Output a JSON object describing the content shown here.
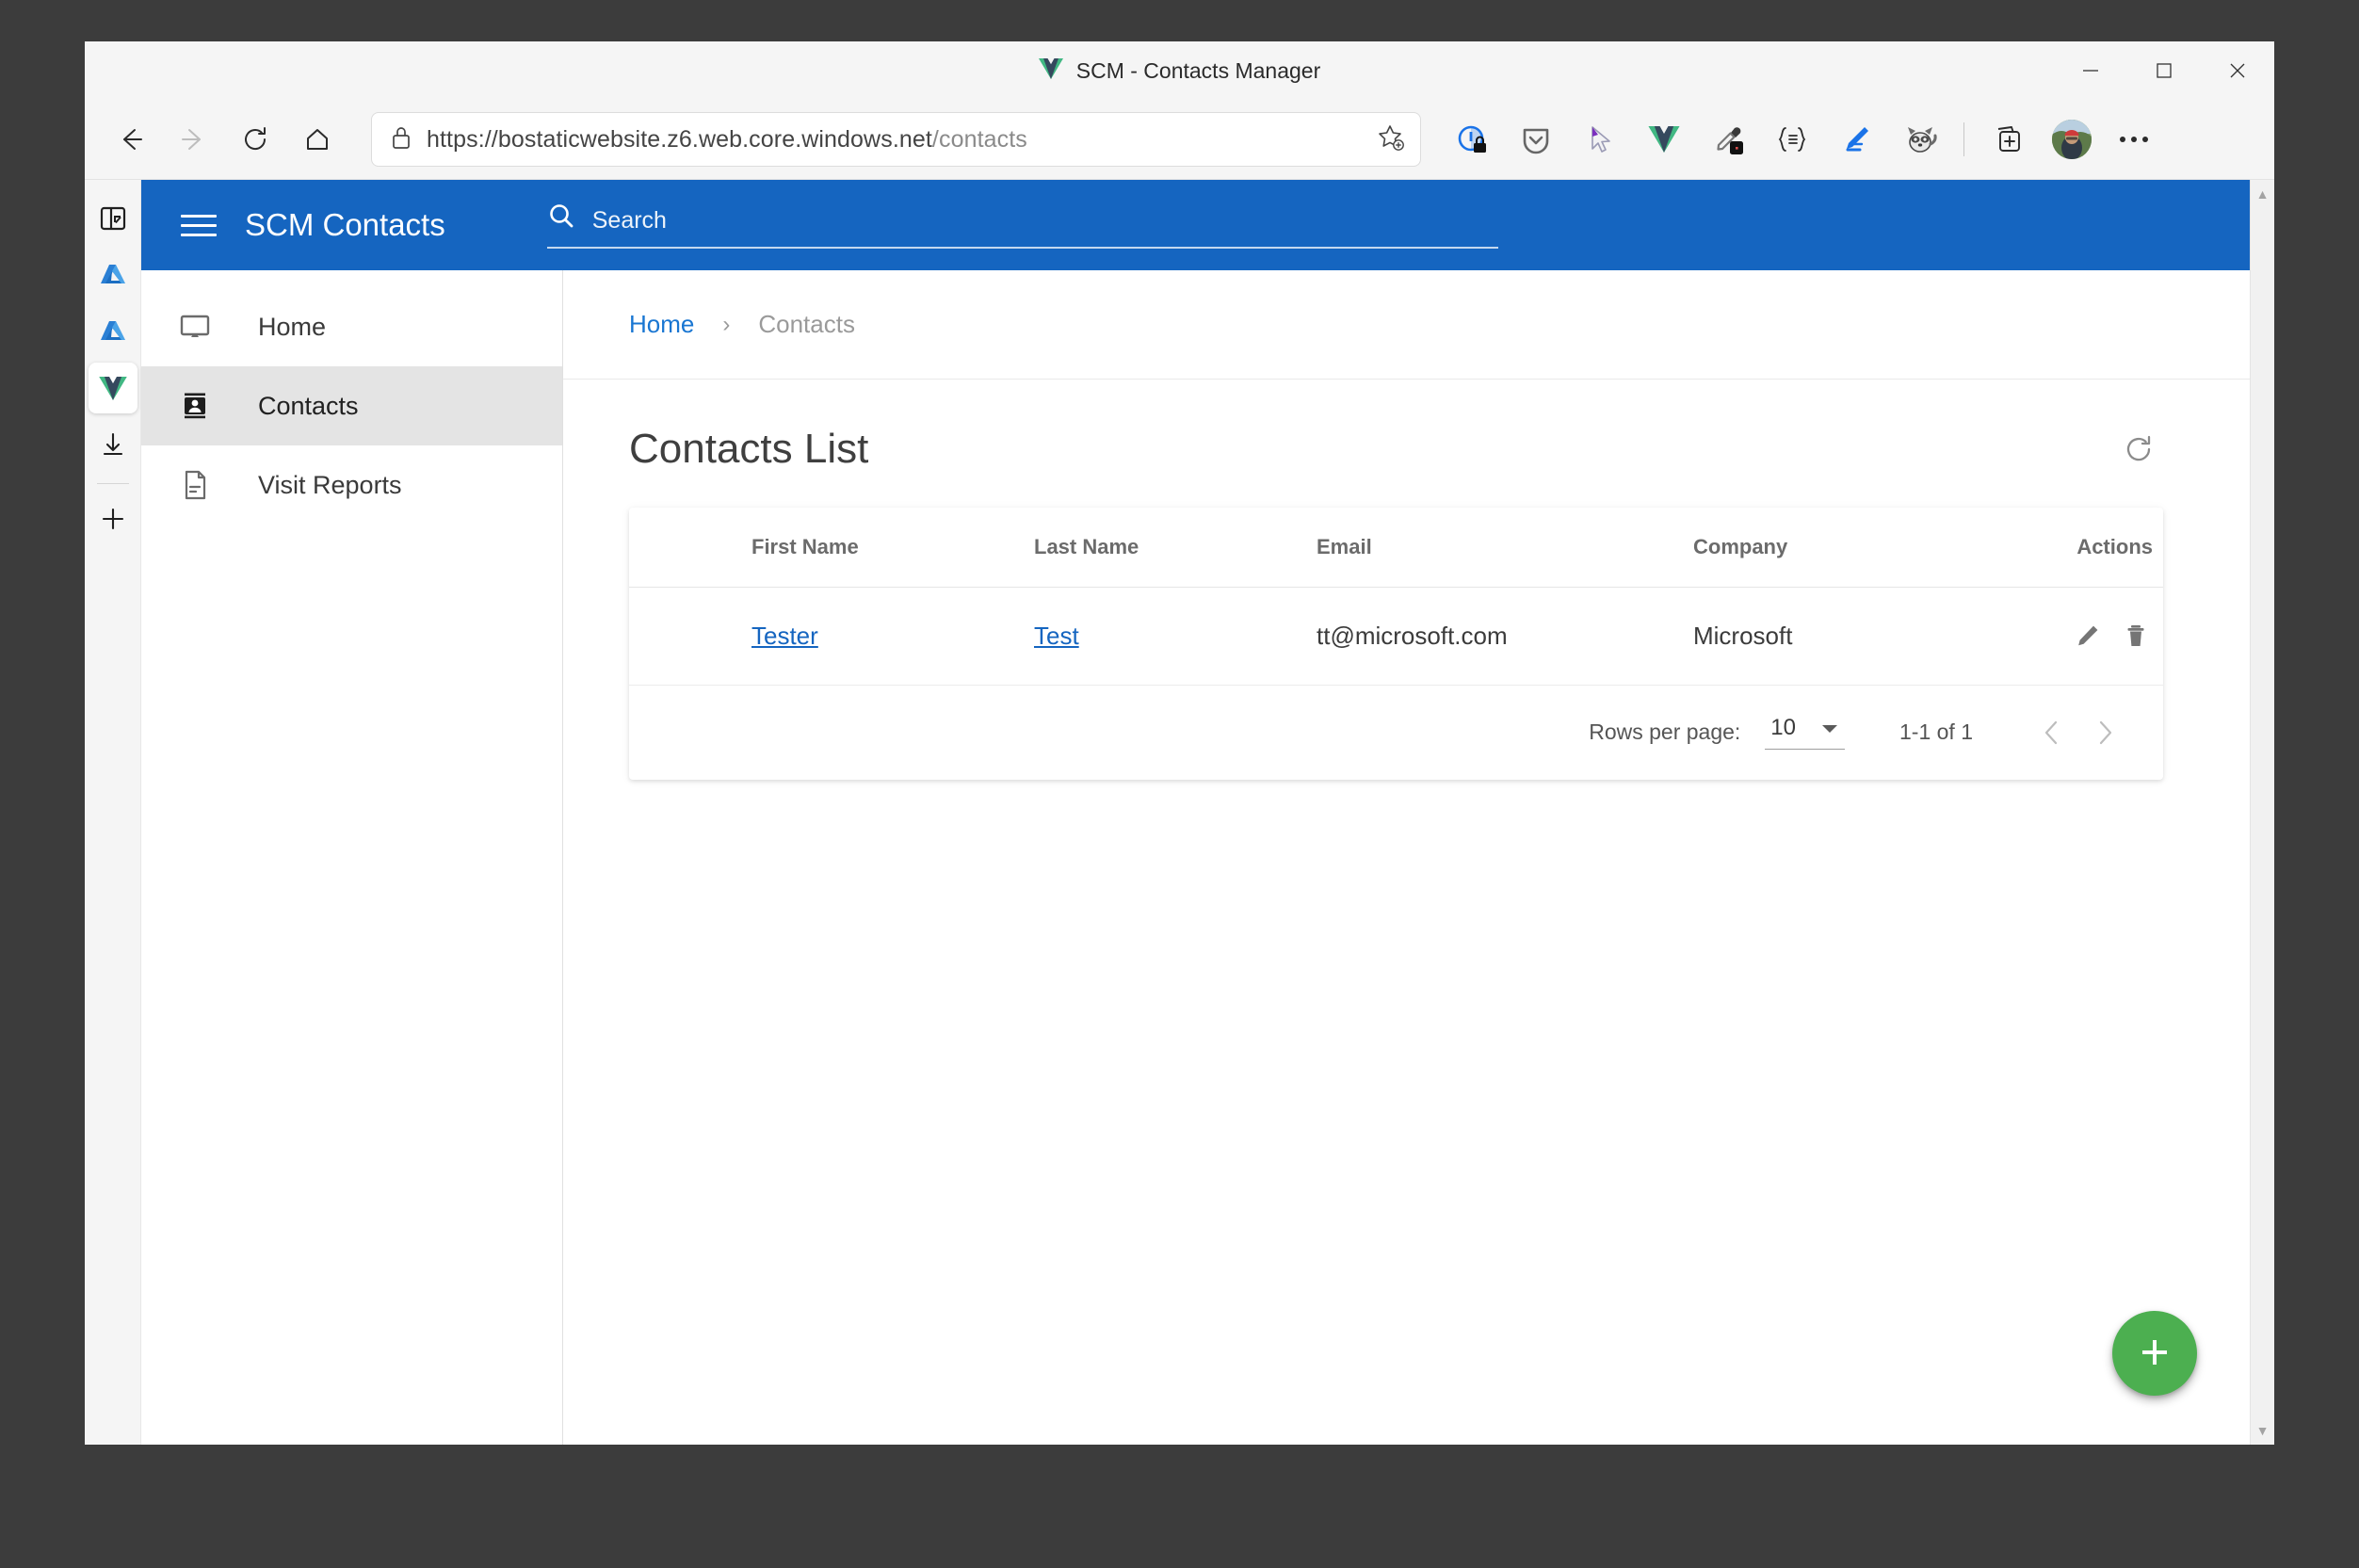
{
  "browser": {
    "window_title": "SCM - Contacts Manager",
    "favicon": "vue-logo-icon",
    "window_controls": {
      "minimize": "minimize-icon",
      "maximize": "maximize-icon",
      "close": "close-icon"
    },
    "nav": {
      "back": "back-arrow-icon",
      "forward": "forward-arrow-icon",
      "reload": "reload-icon",
      "home": "home-icon"
    },
    "url": {
      "lock": "lock-icon",
      "scheme_host": "https://bostaticwebsite.z6.web.core.windows.net",
      "path": "/contacts",
      "full": "https://bostaticwebsite.z6.web.core.windows.net/contacts",
      "favorite": "add-favorite-star-icon"
    },
    "extensions": [
      {
        "name": "privacy-badger-icon"
      },
      {
        "name": "pocket-shield-icon"
      },
      {
        "name": "cursor-pointer-icon"
      },
      {
        "name": "vue-devtools-icon"
      },
      {
        "name": "color-picker-eyedropper-icon"
      },
      {
        "name": "json-formatter-icon"
      },
      {
        "name": "editor-pen-icon"
      },
      {
        "name": "raccoon-extension-icon"
      }
    ],
    "collections": "add-to-collections-icon",
    "profile_avatar": "profile-avatar",
    "more": "more-options-icon",
    "sidebar": [
      {
        "name": "split-screen-icon",
        "active": false
      },
      {
        "name": "azure-icon-1",
        "active": false
      },
      {
        "name": "azure-icon-2",
        "active": false
      },
      {
        "name": "vue-app-icon",
        "active": true
      },
      {
        "name": "downloads-icon",
        "active": false
      },
      {
        "name": "add-sidebar-app-icon",
        "active": false
      }
    ]
  },
  "app": {
    "header": {
      "menu_icon": "hamburger-menu-icon",
      "title": "SCM Contacts",
      "search_icon": "search-icon",
      "search_value": "",
      "search_placeholder": "Search",
      "color": "#1565C0"
    },
    "drawer": {
      "items": [
        {
          "label": "Home",
          "icon": "monitor-icon",
          "active": false
        },
        {
          "label": "Contacts",
          "icon": "contact-card-icon",
          "active": true
        },
        {
          "label": "Visit Reports",
          "icon": "document-icon",
          "active": false
        }
      ]
    },
    "breadcrumb": {
      "home": "Home",
      "separator": "›",
      "current": "Contacts"
    },
    "page": {
      "title": "Contacts List",
      "refresh_icon": "refresh-icon"
    },
    "table": {
      "columns": [
        "",
        "First Name",
        "Last Name",
        "Email",
        "Company",
        "Actions"
      ],
      "rows": [
        {
          "avatar": "contact-avatar",
          "first_name": "Tester",
          "last_name": "Test",
          "email": "tt@microsoft.com",
          "company": "Microsoft",
          "edit_icon": "edit-pencil-icon",
          "delete_icon": "delete-trash-icon"
        }
      ]
    },
    "footer": {
      "rows_per_page_label": "Rows per page:",
      "rows_per_page_value": "10",
      "dropdown_icon": "chevron-down-icon",
      "range": "1-1 of 1",
      "prev_icon": "chevron-left-icon",
      "next_icon": "chevron-right-icon"
    },
    "fab": {
      "icon": "plus-icon",
      "color": "#4CAF50"
    }
  },
  "scrollbar": {
    "up": "▲",
    "down": "▼"
  }
}
